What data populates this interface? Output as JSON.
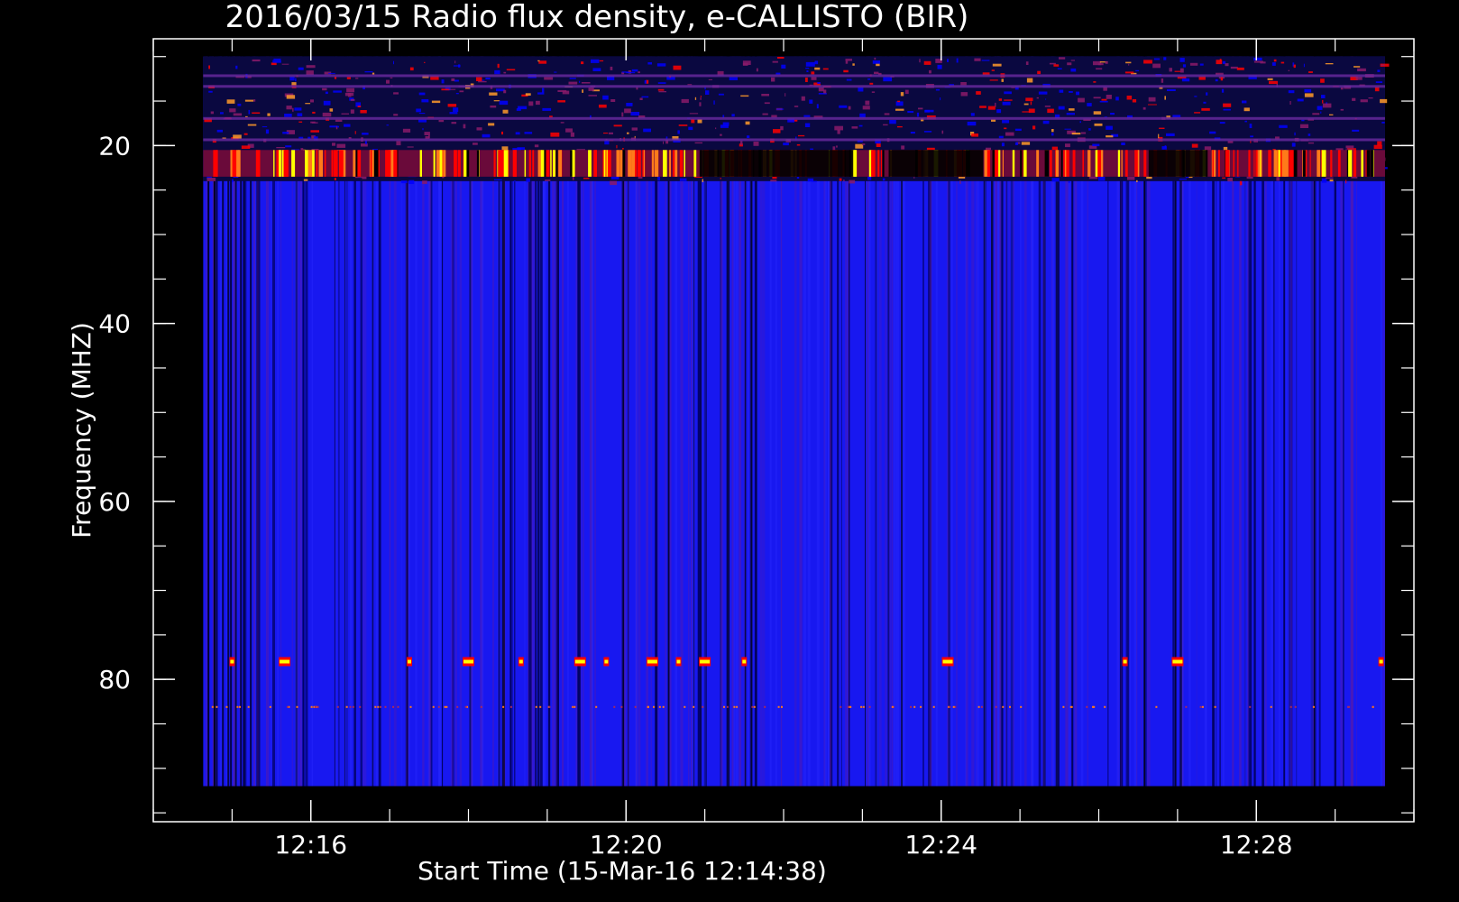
{
  "chart_data": {
    "type": "heatmap",
    "title": "2016/03/15  Radio flux density, e-CALLISTO (BIR)",
    "xlabel": "Start Time (15-Mar-16 12:14:38)",
    "ylabel": "Frequency (MHZ)",
    "x_range": [
      "12:14:38",
      "12:29:38"
    ],
    "xlim": [
      "12:14:00",
      "12:30:00"
    ],
    "ylim": [
      96,
      8
    ],
    "data_y_range": [
      10,
      92
    ],
    "x_ticks": [
      "12:16",
      "12:20",
      "12:24",
      "12:28"
    ],
    "y_ticks": [
      20,
      40,
      60,
      80
    ],
    "colormap": [
      "#000000",
      "#0000ff",
      "#ff0000",
      "#ffff00"
    ],
    "background_color": "#1818f0",
    "features": {
      "rfi_band_mhz": [
        10,
        24
      ],
      "strong_band_mhz": [
        20.5,
        23.5
      ],
      "burst_line_mhz": 78,
      "faint_line_mhz": 83,
      "burst_times": [
        "12:15:00",
        "12:15:40",
        "12:17:15",
        "12:18:00",
        "12:18:40",
        "12:19:25",
        "12:19:45",
        "12:20:20",
        "12:20:40",
        "12:21:00",
        "12:21:30",
        "12:24:05",
        "12:26:20",
        "12:27:00",
        "12:29:35"
      ]
    }
  }
}
